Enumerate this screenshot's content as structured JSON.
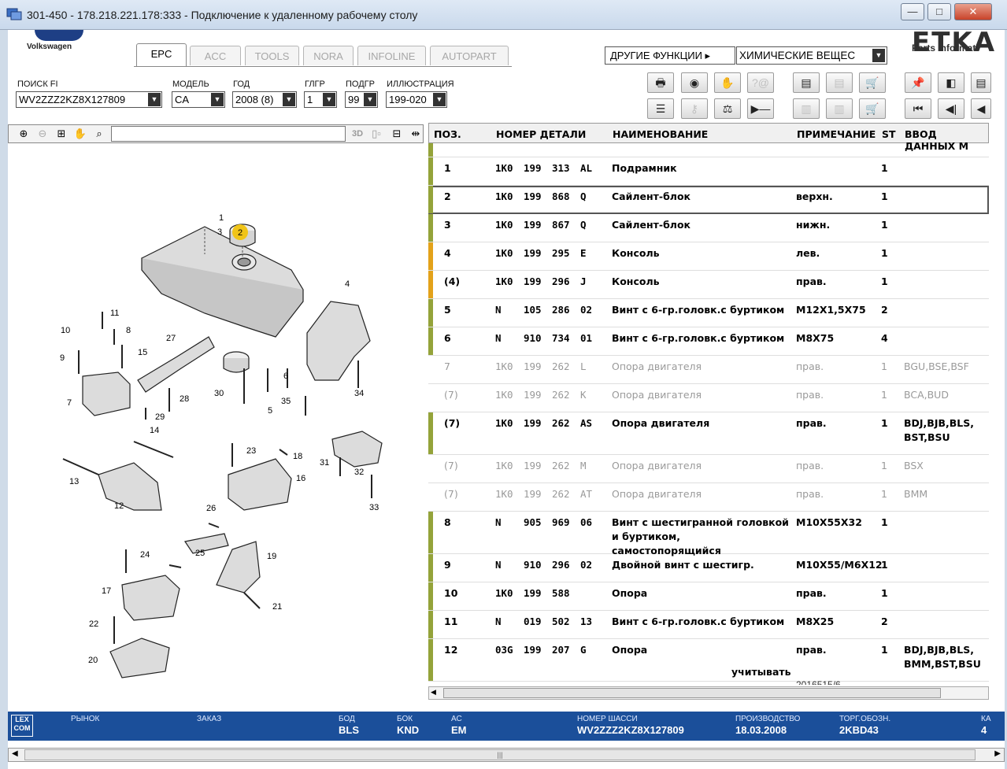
{
  "window": {
    "title": "301-450 - 178.218.221.178:333 - Подключение к удаленному рабочему столу",
    "min": "—",
    "max": "□",
    "close": "✕"
  },
  "brand": {
    "vw": "Volkswagen",
    "etka": "ETKA",
    "etka_sub": "Parts Informati"
  },
  "tabs": [
    {
      "label": "EPC",
      "active": true
    },
    {
      "label": "ACC"
    },
    {
      "label": "TOOLS"
    },
    {
      "label": "NORA"
    },
    {
      "label": "INFOLINE"
    },
    {
      "label": "AUTOPART"
    }
  ],
  "other_functions": {
    "label": "ДРУГИЕ ФУНКЦИИ ▸",
    "value": "ХИМИЧЕСКИЕ ВЕЩЕС"
  },
  "filters": {
    "vin": {
      "label": "ПОИСК FI",
      "value": "WV2ZZZ2KZ8X127809"
    },
    "model": {
      "label": "МОДЕЛЬ",
      "value": "CA"
    },
    "year": {
      "label": "ГОД",
      "value": "2008 (8)"
    },
    "mg": {
      "label": "ГЛГР",
      "value": "1"
    },
    "sg": {
      "label": "ПОДГР",
      "value": "99"
    },
    "illus": {
      "label": "ИЛЛЮСТРАЦИЯ",
      "value": "199-020"
    }
  },
  "diagram_toolbar": {
    "view3d": "3D"
  },
  "grid": {
    "headers": {
      "pos": "ПОЗ.",
      "part": "НОМЕР ДЕТАЛИ",
      "name": "НАИМЕНОВАНИЕ",
      "note": "ПРИМЕЧАНИЕ",
      "st": "ST",
      "entry": "ВВОД ДАННЫХ М"
    },
    "rows": [
      {
        "pos": "1",
        "p1": "1K0",
        "p2": "199",
        "p3": "313",
        "p4": "AL",
        "name": "Подрамник",
        "note": "",
        "st": "1",
        "entry": ""
      },
      {
        "pos": "2",
        "p1": "1K0",
        "p2": "199",
        "p3": "868",
        "p4": "Q",
        "name": "Сайлент-блок",
        "note": "верхн.",
        "st": "1",
        "entry": ""
      },
      {
        "pos": "3",
        "p1": "1K0",
        "p2": "199",
        "p3": "867",
        "p4": "Q",
        "name": "Сайлент-блок",
        "note": "нижн.",
        "st": "1",
        "entry": ""
      },
      {
        "pos": "4",
        "p1": "1K0",
        "p2": "199",
        "p3": "295",
        "p4": "E",
        "name": "Консоль",
        "note": "лев.",
        "st": "1",
        "entry": ""
      },
      {
        "pos": "(4)",
        "p1": "1K0",
        "p2": "199",
        "p3": "296",
        "p4": "J",
        "name": "Консоль",
        "note": "прав.",
        "st": "1",
        "entry": ""
      },
      {
        "pos": "5",
        "p1": "N",
        "p2": "105",
        "p3": "286",
        "p4": "02",
        "name": "Винт с 6-гр.головк.с буртиком",
        "note": "M12X1,5X75",
        "st": "2",
        "entry": ""
      },
      {
        "pos": "6",
        "p1": "N",
        "p2": "910",
        "p3": "734",
        "p4": "01",
        "name": "Винт с 6-гр.головк.с буртиком",
        "note": "M8X75",
        "st": "4",
        "entry": ""
      },
      {
        "pos": "7",
        "p1": "1K0",
        "p2": "199",
        "p3": "262",
        "p4": "L",
        "name": "Опора двигателя",
        "note": "прав.",
        "st": "1",
        "entry": "BGU,BSE,BSF"
      },
      {
        "pos": "(7)",
        "p1": "1K0",
        "p2": "199",
        "p3": "262",
        "p4": "K",
        "name": "Опора двигателя",
        "note": "прав.",
        "st": "1",
        "entry": "BCA,BUD"
      },
      {
        "pos": "(7)",
        "p1": "1K0",
        "p2": "199",
        "p3": "262",
        "p4": "AS",
        "name": "Опора двигателя",
        "note": "прав.",
        "st": "1",
        "entry": "BDJ,BJB,BLS, BST,BSU"
      },
      {
        "pos": "(7)",
        "p1": "1K0",
        "p2": "199",
        "p3": "262",
        "p4": "M",
        "name": "Опора двигателя",
        "note": "прав.",
        "st": "1",
        "entry": "BSX"
      },
      {
        "pos": "(7)",
        "p1": "1K0",
        "p2": "199",
        "p3": "262",
        "p4": "AT",
        "name": "Опора двигателя",
        "note": "прав.",
        "st": "1",
        "entry": "BMM"
      },
      {
        "pos": "8",
        "p1": "N",
        "p2": "905",
        "p3": "969",
        "p4": "06",
        "name": "Винт с шестигранной головкой и буртиком, самостопорящийся",
        "note": "M10X55X32",
        "st": "1",
        "entry": ""
      },
      {
        "pos": "9",
        "p1": "N",
        "p2": "910",
        "p3": "296",
        "p4": "02",
        "name": "Двойной винт с шестигр.",
        "note": "M10X55/M6X12",
        "st": "1",
        "entry": ""
      },
      {
        "pos": "10",
        "p1": "1K0",
        "p2": "199",
        "p3": "588",
        "p4": "",
        "name": "Опора",
        "note": "прав.",
        "st": "1",
        "entry": ""
      },
      {
        "pos": "11",
        "p1": "N",
        "p2": "019",
        "p3": "502",
        "p4": "13",
        "name": "Винт с 6-гр.головк.с буртиком",
        "note": "M8X25",
        "st": "2",
        "entry": ""
      },
      {
        "pos": "12",
        "p1": "03G",
        "p2": "199",
        "p3": "207",
        "p4": "G",
        "name": "Опора",
        "note": "прав.",
        "st": "1",
        "entry": "BDJ,BJB,BLS, BMM,BST,BSU"
      }
    ],
    "footnote": "учитывать",
    "footnote2": "2016515/6"
  },
  "status": {
    "logo": "LEX COM",
    "market_label": "РЫНОК",
    "market": "",
    "order_label": "ЗАКАЗ",
    "order": "",
    "bod_label": "БОД",
    "bod": "BLS",
    "bok_label": "БОК",
    "bok": "KND",
    "ac_label": "АС",
    "ac": "EM",
    "chassis_label": "НОМЕР ШАССИ",
    "chassis": "WV2ZZZ2KZ8X127809",
    "prod_label": "ПРОИЗВОДСТВО",
    "prod": "18.03.2008",
    "trade_label": "ТОРГ.ОБОЗН.",
    "trade": "2KBD43",
    "k_label": "КА",
    "k": "4"
  },
  "colors": {
    "bar_green": "#94a33a",
    "bar_orange": "#e3a21a",
    "status_bg": "#1b4f9a"
  }
}
